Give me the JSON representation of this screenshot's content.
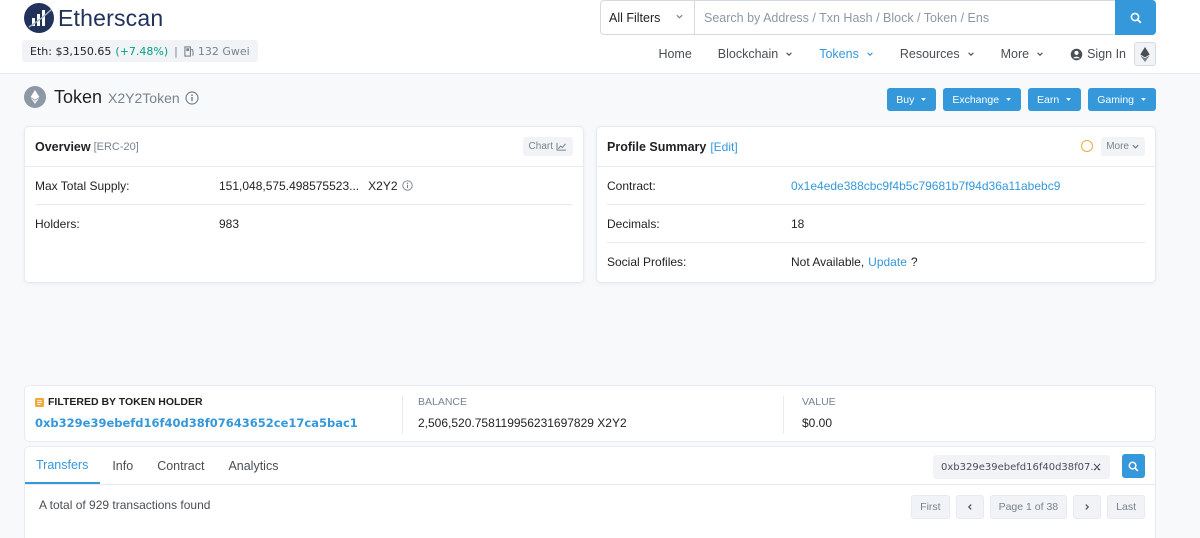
{
  "header": {
    "logo_text": "Etherscan",
    "eth_price_label": "Eth: $3,150.65",
    "eth_change": "(+7.48%)",
    "separator": "|",
    "gas": "132 Gwei",
    "search": {
      "filter_value": "All Filters",
      "placeholder": "Search by Address / Txn Hash / Block / Token / Ens"
    },
    "nav": {
      "home": "Home",
      "blockchain": "Blockchain",
      "tokens": "Tokens",
      "resources": "Resources",
      "more": "More",
      "sign_in": "Sign In"
    }
  },
  "title": {
    "main": "Token",
    "sub": "X2Y2Token"
  },
  "actions": {
    "buy": "Buy",
    "exchange": "Exchange",
    "earn": "Earn",
    "gaming": "Gaming"
  },
  "overview": {
    "title": "Overview",
    "tag": "[ERC-20]",
    "chart_label": "Chart",
    "max_supply_label": "Max Total Supply:",
    "max_supply_value": "151,048,575.498575523...",
    "max_supply_symbol": "X2Y2",
    "holders_label": "Holders:",
    "holders_value": "983"
  },
  "profile": {
    "title": "Profile Summary",
    "edit": "[Edit]",
    "more_label": "More",
    "contract_label": "Contract:",
    "contract_value": "0x1e4ede388cbc9f4b5c79681b7f94d36a11abebc9",
    "decimals_label": "Decimals:",
    "decimals_value": "18",
    "social_label": "Social Profiles:",
    "social_value": "Not Available,",
    "social_update": "Update",
    "social_q": "?"
  },
  "filter": {
    "holder_label": "FILTERED BY TOKEN HOLDER",
    "holder_address": "0xb329e39ebefd16f40d38f07643652ce17ca5bac1",
    "balance_label": "BALANCE",
    "balance_value": "2,506,520.758119956231697829 X2Y2",
    "value_label": "VALUE",
    "value_value": "$0.00"
  },
  "tabs": {
    "transfers": "Transfers",
    "info": "Info",
    "contract": "Contract",
    "analytics": "Analytics",
    "holder_chip": "0xb329e39ebefd16f40d38f07...",
    "clear": "×"
  },
  "transactions": {
    "count_text": "A total of 929 transactions found",
    "first": "First",
    "page": "Page 1 of 38",
    "last": "Last"
  },
  "colors": {
    "accent": "#3498db",
    "brand": "#21325b",
    "positive": "#00a186"
  }
}
